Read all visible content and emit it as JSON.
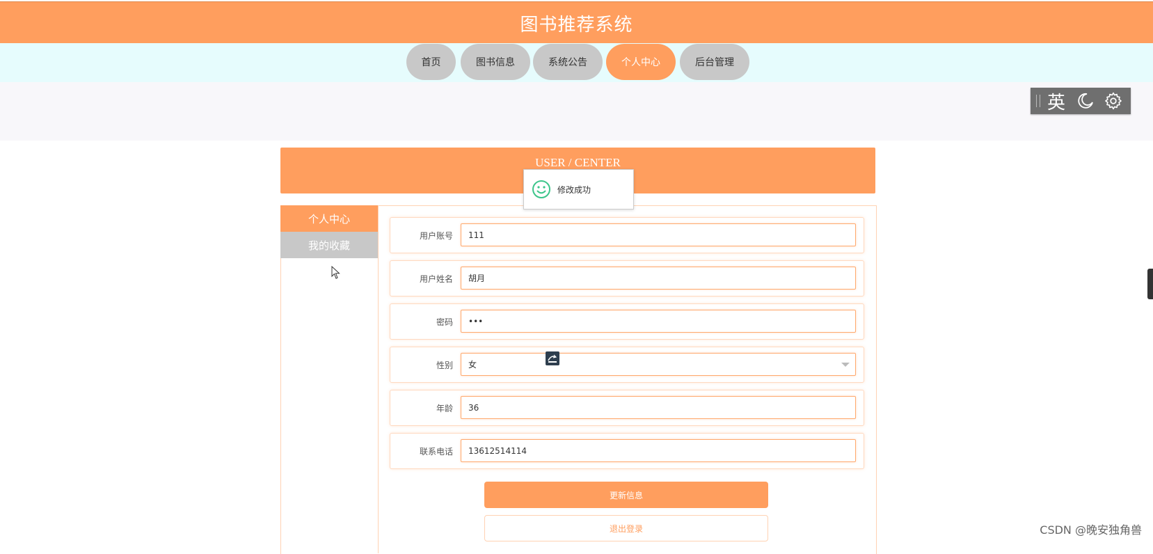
{
  "header": {
    "title": "图书推荐系统"
  },
  "nav": {
    "items": [
      {
        "label": "首页"
      },
      {
        "label": "图书信息"
      },
      {
        "label": "系统公告"
      },
      {
        "label": "个人中心"
      },
      {
        "label": "后台管理"
      }
    ],
    "active": "个人中心"
  },
  "tools": {
    "lang": "英",
    "icons": [
      "moon-icon",
      "gear-icon"
    ]
  },
  "banner": {
    "title": "USER / CENTER"
  },
  "toast": {
    "message": "修改成功",
    "icon": "smile-icon"
  },
  "sidebar": {
    "items": [
      {
        "label": "个人中心"
      },
      {
        "label": "我的收藏"
      }
    ]
  },
  "form": {
    "fields": [
      {
        "label": "用户账号",
        "value": "111"
      },
      {
        "label": "用户姓名",
        "value": "胡月"
      },
      {
        "label": "密码",
        "value": "•••"
      },
      {
        "label": "性别",
        "value": "女"
      },
      {
        "label": "年龄",
        "value": "36"
      },
      {
        "label": "联系电话",
        "value": "13612514114"
      }
    ],
    "update_label": "更新信息",
    "logout_label": "退出登录"
  },
  "watermark": "CSDN @晚安独角兽",
  "colors": {
    "accent": "#ff9e5e",
    "nav_bg": "#e6fcfd",
    "inactive": "#c8c8c8"
  }
}
